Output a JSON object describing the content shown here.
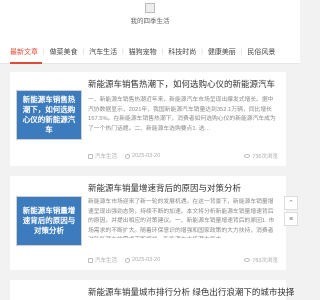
{
  "header": {
    "site_name": "我的四季生活"
  },
  "nav": {
    "items": [
      {
        "label": "最新文章",
        "active": true
      },
      {
        "label": "做菜美食",
        "active": false
      },
      {
        "label": "汽车生活",
        "active": false
      },
      {
        "label": "猫狗宠物",
        "active": false
      },
      {
        "label": "科技时尚",
        "active": false
      },
      {
        "label": "健康美丽",
        "active": false
      },
      {
        "label": "民俗风景",
        "active": false
      }
    ]
  },
  "articles": [
    {
      "title": "新能源车销售热潮下，如何选购心仪的新能源汽车",
      "thumb_text": "新能源车销售热潮下，如何选购心仪的新能源汽车",
      "excerpt": "一、新能源车销售热潮近年来，新能源汽车市场呈现出爆发式增长。据中汽协数据显示，2021年，我国新能源汽车销量达到352.1万辆，同比增长157.5%。在新能源车销售热潮下，消费者如何选购心仪的新能源汽车成为了一个热门话题。二、新能源车选购要点1. 选…",
      "category": "汽车生活",
      "date": "2025-03-20",
      "views": "736次浏览"
    },
    {
      "title": "新能源车销量增速背后的原因与对策分析",
      "thumb_text": "新能源车销量增速背后的原因与对策分析",
      "excerpt": "新能源车市场迎来了新一轮的发展机遇。在这一背景下，新能源车销量增速呈现出强劲态势，持续不断的加速。本文将分析新能源车销量增速背后的原因，并提出相应的对策建议。一、新能源车销量增速背后的原因1. 市场需求的不断扩大。随着环保意识的增强和国家政策的大力扶持，消费者对新能源车的需求不断增加，新能源车市场潜力巨大。",
      "category": "汽车生活",
      "date": "2025-03-20",
      "views": "783次浏览"
    },
    {
      "title": "新能源车销量城市排行分析 绿色出行浪潮下的城市抉择",
      "thumb_text": "",
      "excerpt": "",
      "category": "",
      "date": "",
      "views": ""
    }
  ]
}
